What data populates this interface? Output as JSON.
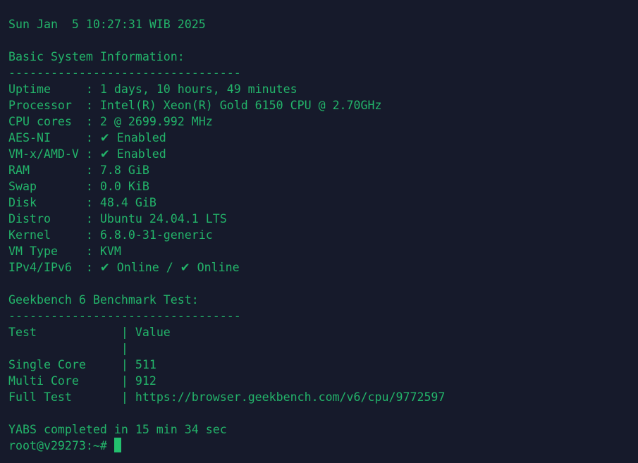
{
  "date_line": "Sun Jan  5 10:27:31 WIB 2025",
  "basic": {
    "title": "Basic System Information:",
    "divider": "---------------------------------",
    "rows": [
      {
        "label": "Uptime     ",
        "value": "1 days, 10 hours, 49 minutes"
      },
      {
        "label": "Processor  ",
        "value": "Intel(R) Xeon(R) Gold 6150 CPU @ 2.70GHz"
      },
      {
        "label": "CPU cores  ",
        "value": "2 @ 2699.992 MHz"
      },
      {
        "label": "AES-NI     ",
        "check": "✔",
        "value": "Enabled"
      },
      {
        "label": "VM-x/AMD-V ",
        "check": "✔",
        "value": "Enabled"
      },
      {
        "label": "RAM        ",
        "value": "7.8 GiB"
      },
      {
        "label": "Swap       ",
        "value": "0.0 KiB"
      },
      {
        "label": "Disk       ",
        "value": "48.4 GiB"
      },
      {
        "label": "Distro     ",
        "value": "Ubuntu 24.04.1 LTS"
      },
      {
        "label": "Kernel     ",
        "value": "6.8.0-31-generic"
      },
      {
        "label": "VM Type    ",
        "value": "KVM"
      }
    ],
    "ip": {
      "label": "IPv4/IPv6  ",
      "check": "✔",
      "v4": "Online",
      "sep": " / ",
      "v6": "Online"
    }
  },
  "geekbench": {
    "title": "Geekbench 6 Benchmark Test:",
    "divider": "---------------------------------",
    "header": {
      "test": "Test            ",
      "value": "Value"
    },
    "rows": [
      {
        "test": "                ",
        "value": ""
      },
      {
        "test": "Single Core     ",
        "value": "511"
      },
      {
        "test": "Multi Core      ",
        "value": "912"
      },
      {
        "test": "Full Test       ",
        "value": "https://browser.geekbench.com/v6/cpu/9772597"
      }
    ]
  },
  "completed": "YABS completed in 15 min 34 sec",
  "prompt": "root@v29273:~# "
}
